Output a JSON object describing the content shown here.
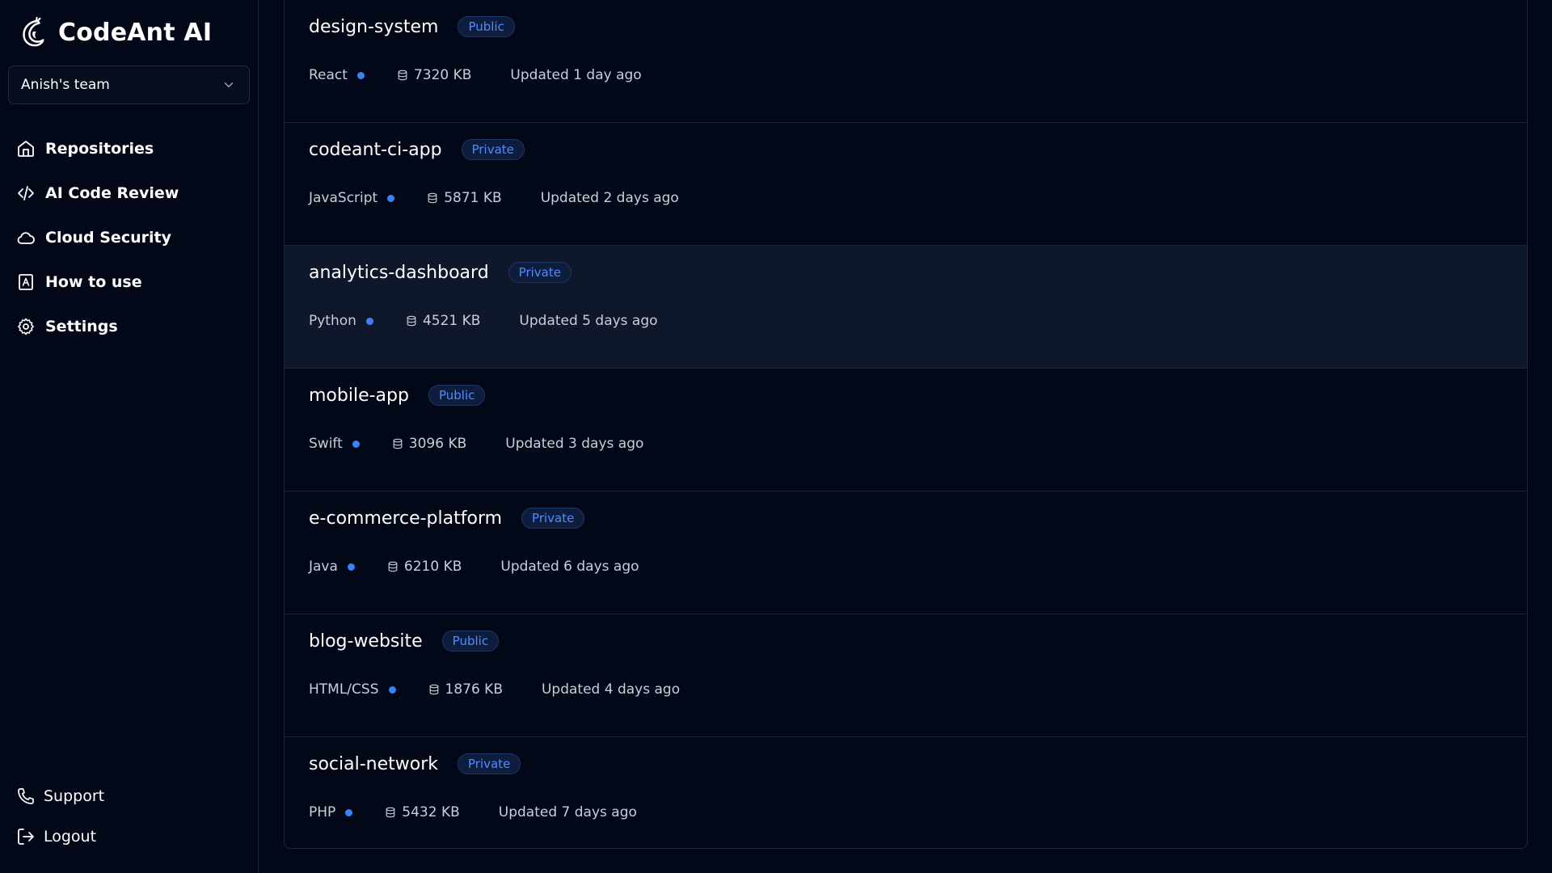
{
  "brand": {
    "name": "CodeAnt AI",
    "logo_icon": "codeant-logo-icon"
  },
  "team_selector": {
    "value": "Anish's team",
    "icon": "chevron-down-icon"
  },
  "nav": {
    "items": [
      {
        "label": "Repositories",
        "icon": "home-icon"
      },
      {
        "label": "AI Code Review",
        "icon": "code-icon"
      },
      {
        "label": "Cloud Security",
        "icon": "cloud-icon"
      },
      {
        "label": "How to use",
        "icon": "book-icon"
      },
      {
        "label": "Settings",
        "icon": "gear-icon"
      }
    ]
  },
  "bottom_nav": {
    "items": [
      {
        "label": "Support",
        "icon": "phone-icon"
      },
      {
        "label": "Logout",
        "icon": "logout-icon"
      }
    ]
  },
  "repositories": [
    {
      "name": "design-system",
      "visibility": "Public",
      "language": "React",
      "size": "7320 KB",
      "updated": "Updated 1 day ago"
    },
    {
      "name": "codeant-ci-app",
      "visibility": "Private",
      "language": "JavaScript",
      "size": "5871 KB",
      "updated": "Updated 2 days ago"
    },
    {
      "name": "analytics-dashboard",
      "visibility": "Private",
      "language": "Python",
      "size": "4521 KB",
      "updated": "Updated 5 days ago"
    },
    {
      "name": "mobile-app",
      "visibility": "Public",
      "language": "Swift",
      "size": "3096 KB",
      "updated": "Updated 3 days ago"
    },
    {
      "name": "e-commerce-platform",
      "visibility": "Private",
      "language": "Java",
      "size": "6210 KB",
      "updated": "Updated 6 days ago"
    },
    {
      "name": "blog-website",
      "visibility": "Public",
      "language": "HTML/CSS",
      "size": "1876 KB",
      "updated": "Updated 4 days ago"
    },
    {
      "name": "social-network",
      "visibility": "Private",
      "language": "PHP",
      "size": "5432 KB",
      "updated": "Updated 7 days ago"
    }
  ],
  "colors": {
    "background": "#020817",
    "highlight_row": "#0f172a",
    "accent": "#3b82f6",
    "badge_text": "#4c8dff",
    "border": "#1e2638"
  }
}
